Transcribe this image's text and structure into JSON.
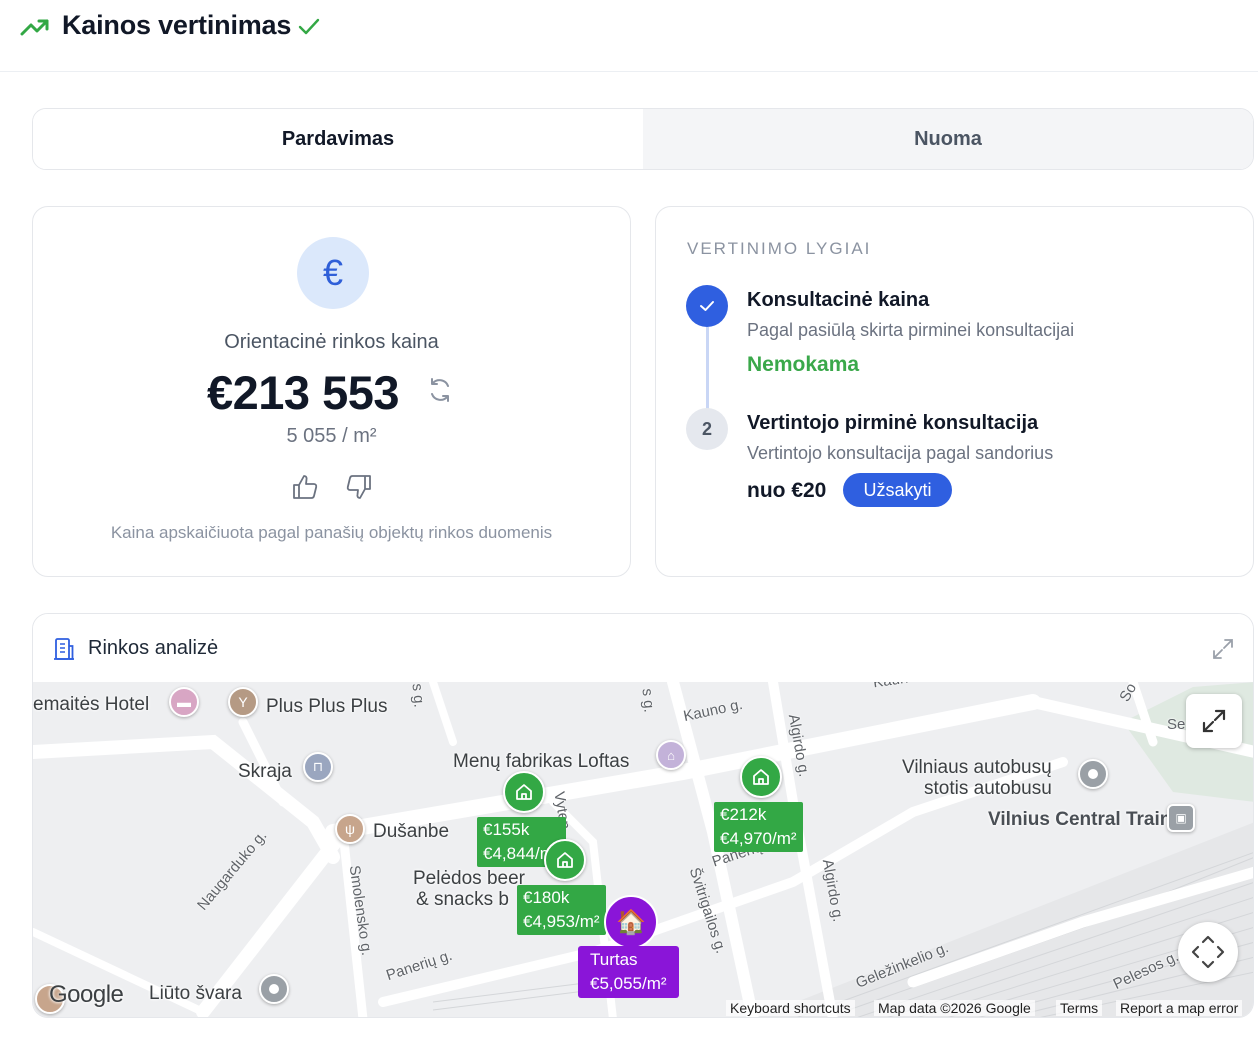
{
  "header": {
    "title": "Kainos vertinimas"
  },
  "tabs": [
    {
      "label": "Pardavimas",
      "active": true
    },
    {
      "label": "Nuoma",
      "active": false
    }
  ],
  "estimate": {
    "label": "Orientacinė rinkos kaina",
    "price": "€213 553",
    "per_m2": "5 055 / m²",
    "footnote": "Kaina apskaičiuota pagal panašių objektų rinkos duomenis",
    "currency_icon": "€"
  },
  "levels": {
    "title": "VERTINIMO LYGIAI",
    "items": [
      {
        "title": "Konsultacinė kaina",
        "subtitle": "Pagal pasiūlą skirta pirminei konsultacijai",
        "price": "Nemokama",
        "status": "done"
      },
      {
        "step": "2",
        "title": "Vertintojo pirminė konsultacija",
        "subtitle": "Vertintojo konsultacija pagal sandorius",
        "price": "nuo €20",
        "button": "Užsakyti"
      }
    ]
  },
  "map_section": {
    "title": "Rinkos analizė",
    "pois": {
      "hotel": "emaitės Hotel",
      "bar": "Plus Plus Plus",
      "skraja": "Skraja",
      "restaurant": "Menų fabrikas Loftas",
      "dusanbe": "Dušanbe",
      "peledos1": "Pelėdos beer",
      "peledos2": "& snacks b",
      "bus1": "Vilniaus autobusų",
      "bus2": "stotis autobusu",
      "train": "Vilnius Central Train",
      "liuto": "Liūto švara"
    },
    "streets": {
      "kauno": "Kauno g.",
      "algirdo1": "Algirdo g.",
      "algirdo2": "Algirdo g.",
      "naugarduko": "Naugarduko g.",
      "smolensko": "Smolensko g.",
      "paneriu1": "Panerių g.",
      "paneriu2": "Panerių g",
      "svitrigailos": "Švitrigailos g.",
      "gelezinkelio": "Geležinkelio g.",
      "pelesos": "Pelesos g.",
      "vyten": "Vyten",
      "sg1": "s g.",
      "sg2": "s g.",
      "kaun": "Kaun",
      "so": "So",
      "se": "Se"
    },
    "listings": [
      {
        "price": "€155k",
        "per_m2": "€4,844/m²"
      },
      {
        "price": "€180k",
        "per_m2": "€4,953/m²"
      },
      {
        "price": "€212k",
        "per_m2": "€4,970/m²"
      }
    ],
    "target": {
      "label": "Turtas",
      "per_m2": "€5,055/m²",
      "icon": "🏠"
    },
    "google_logo": "Google",
    "attribution": {
      "shortcuts": "Keyboard shortcuts",
      "data": "Map data ©2026 Google",
      "terms": "Terms",
      "report": "Report a map error"
    }
  },
  "colors": {
    "accent": "#2f5fe0",
    "success": "#33a845",
    "target": "#8a15d8"
  }
}
